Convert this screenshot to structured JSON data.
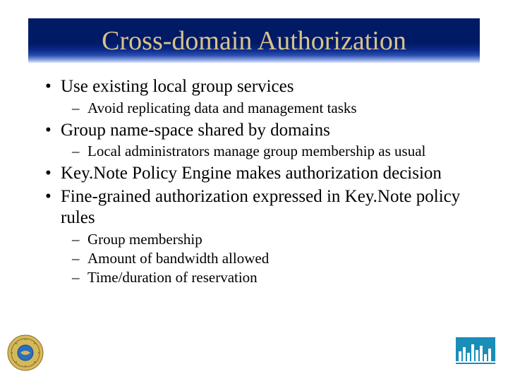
{
  "title": "Cross-domain Authorization",
  "bullets": [
    {
      "text": "Use existing local group services",
      "sub": [
        "Avoid replicating data and management tasks"
      ]
    },
    {
      "text": "Group name-space shared by domains",
      "sub": [
        "Local administrators manage group membership as usual"
      ]
    },
    {
      "text": "Key.Note Policy Engine makes authorization decision",
      "sub": []
    },
    {
      "text": "Fine-grained authorization expressed in Key.Note policy rules",
      "sub": [
        "Group membership",
        "Amount of bandwidth allowed",
        "Time/duration of reservation"
      ]
    }
  ]
}
